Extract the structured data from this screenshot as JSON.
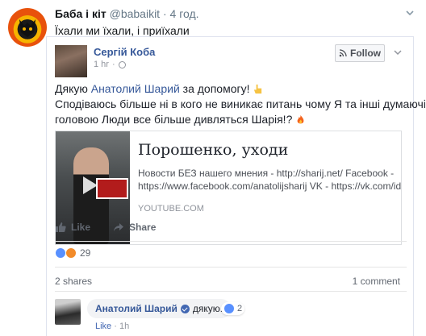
{
  "tweet": {
    "name": "Баба і кіт",
    "handle": "@babaikit",
    "separator": "·",
    "time": "4 год.",
    "text": "Їхали ми їхали, і приїхали"
  },
  "fb_post": {
    "author": "Сергій Коба",
    "time": "1 hr",
    "separator": "·",
    "follow_label": "Follow",
    "text_line1_a": "Дякую ",
    "text_line1_mention": "Анатолий Шарий",
    "text_line1_b": " за допомогу!",
    "text_line2": "Сподіваюсь більше ні в кого не виникає питань чому Я та інші думаючі",
    "text_line3": "головою Люди все більше дивляться Шарія!?",
    "link": {
      "title": "Порошенко, уходи",
      "desc_line1": "Новости БЕЗ нашего мнения - http://sharij.net/ Facebook -",
      "desc_line2": "https://www.facebook.com/anatolijsharij VK - https://vk.com/id...",
      "domain": "YOUTUBE.COM"
    },
    "like_label": "Like",
    "share_label": "Share",
    "reaction_count": "29",
    "shares": "2 shares",
    "comments": "1 comment"
  },
  "comment": {
    "author": "Анатолий Шарий",
    "text": "дякую.",
    "reaction_count": "2",
    "like_label": "Like",
    "separator": "·",
    "time": "1h"
  },
  "colors": {
    "fb_link": "#365899",
    "twitter_gray": "#657786",
    "like_blue": "#5890ff",
    "angry_orange": "#f28b2a"
  }
}
